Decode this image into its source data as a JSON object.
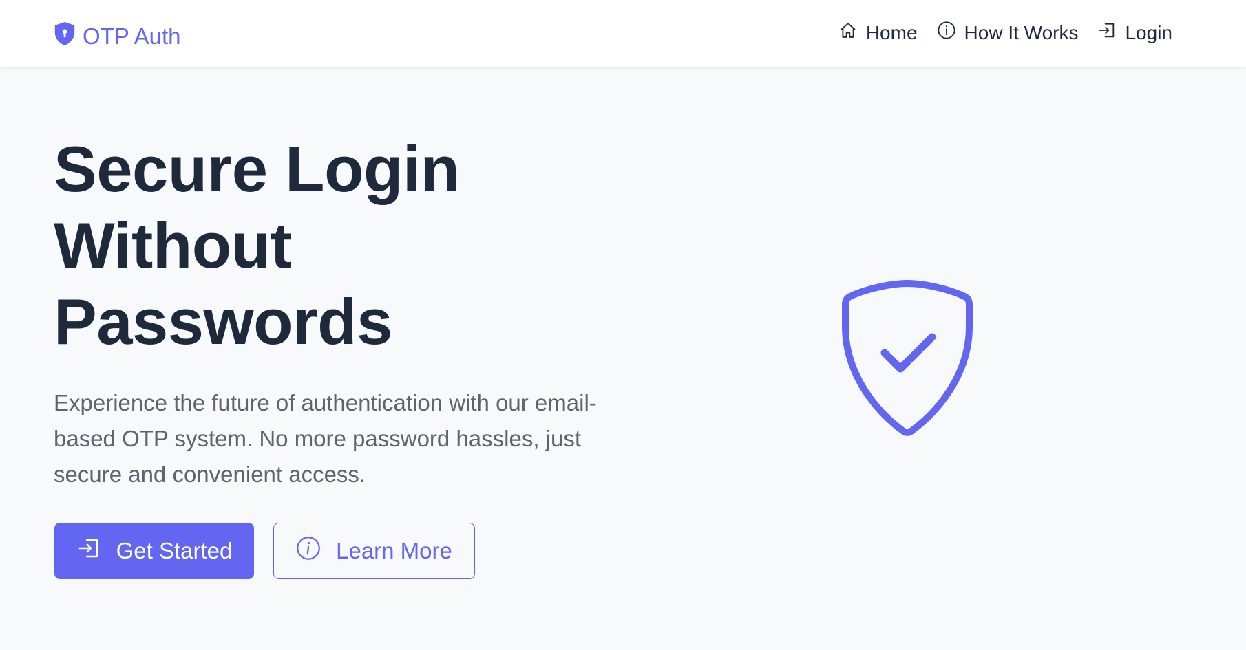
{
  "navbar": {
    "brand": {
      "label": "OTP Auth",
      "icon": "shield-lock-icon"
    },
    "links": [
      {
        "label": "Home",
        "icon": "house-icon"
      },
      {
        "label": "How It Works",
        "icon": "info-circle-icon"
      },
      {
        "label": "Login",
        "icon": "login-arrow-icon"
      }
    ]
  },
  "hero": {
    "title_lines": [
      "Secure Login",
      "Without",
      "Passwords"
    ],
    "lead": "Experience the future of authentication with our email-based OTP system. No more password hassles, just secure and convenient access.",
    "primary_button": {
      "label": "Get Started",
      "icon": "login-arrow-icon"
    },
    "secondary_button": {
      "label": "Learn More",
      "icon": "info-circle-icon"
    },
    "illustration_icon": "shield-check-icon"
  },
  "colors": {
    "accent": "#6366f1",
    "text_dark": "#1e293b",
    "text_muted": "#5b6470",
    "background": "#f8f9fa",
    "navbar_bg": "#ffffff"
  }
}
